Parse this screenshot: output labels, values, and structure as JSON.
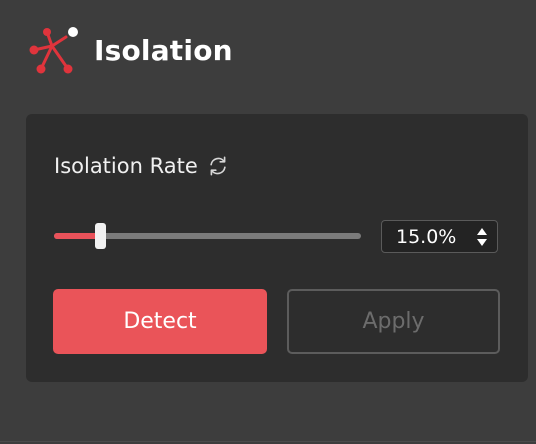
{
  "header": {
    "title": "Isolation",
    "logo_icon": "network-node-icon"
  },
  "colors": {
    "accent": "#ea5459",
    "background": "#3d3d3d",
    "panel": "#2d2d2d"
  },
  "isolation_rate": {
    "label": "Isolation Rate",
    "label_icon": "refresh-icon",
    "slider_value": 0.15,
    "value_display": "15.0%",
    "spinner_icon": "up-down-spinner-icon"
  },
  "buttons": {
    "detect_label": "Detect",
    "apply_label": "Apply",
    "apply_enabled": false
  }
}
